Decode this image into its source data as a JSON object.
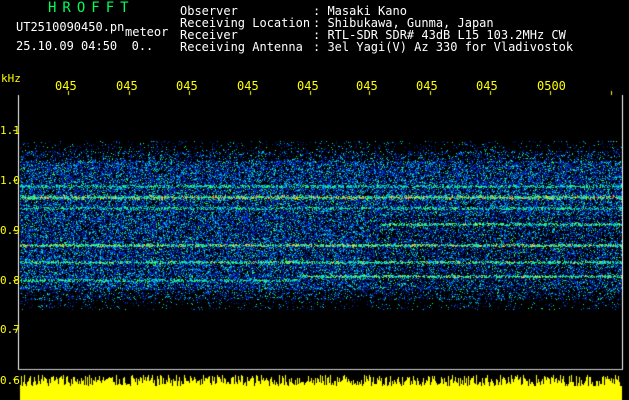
{
  "header": {
    "brand": "HROFFT",
    "filename": "UT2510090450.pn",
    "subtitle": "meteor",
    "datetime": "25.10.09 04:50",
    "counter": "0..",
    "meta": [
      {
        "label": "Observer",
        "value": ": Masaki Kano"
      },
      {
        "label": "Receiving Location",
        "value": ": Shibukawa, Gunma, Japan"
      },
      {
        "label": "Receiver",
        "value": ": RTL-SDR SDR# 43dB L15 103.2MHz CW"
      },
      {
        "label": "Receiving Antenna",
        "value": ": 3el Yagi(V) Az 330 for Vladivostok"
      }
    ]
  },
  "time_axis": {
    "labels": [
      "045",
      "045",
      "045",
      "045",
      "045",
      "045",
      "045",
      "045",
      "0500"
    ]
  },
  "freq_axis": {
    "unit": "kHz",
    "labels": [
      "1.1",
      "1.0",
      "0.9",
      "0.8",
      "0.7",
      "0.6"
    ]
  },
  "colors": {
    "axis_text": "#ffff00",
    "brand": "#00ff55",
    "background": "#000000",
    "audio_level": "#ffff00"
  }
}
